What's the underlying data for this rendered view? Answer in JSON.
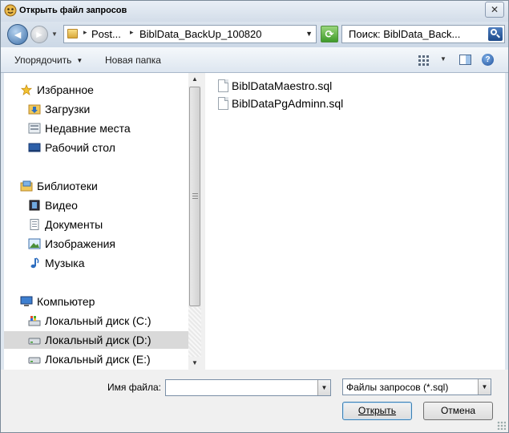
{
  "window": {
    "title": "Открыть файл запросов",
    "close_label": "✕"
  },
  "address": {
    "crumbs": [
      "Post...",
      "BiblData_BackUp_100820"
    ],
    "search_placeholder": "Поиск: BiblData_Back..."
  },
  "toolbar": {
    "organize_label": "Упорядочить",
    "new_folder_label": "Новая папка",
    "help_label": "?"
  },
  "nav": {
    "favorites": {
      "label": "Избранное",
      "icon": "star-icon"
    },
    "favorite_items": [
      {
        "label": "Загрузки",
        "icon": "downloads-folder-icon"
      },
      {
        "label": "Недавние места",
        "icon": "recent-places-icon"
      },
      {
        "label": "Рабочий стол",
        "icon": "desktop-icon"
      }
    ],
    "libraries": {
      "label": "Библиотеки",
      "icon": "libraries-icon"
    },
    "library_items": [
      {
        "label": "Видео",
        "icon": "video-icon"
      },
      {
        "label": "Документы",
        "icon": "documents-icon"
      },
      {
        "label": "Изображения",
        "icon": "pictures-icon"
      },
      {
        "label": "Музыка",
        "icon": "music-icon"
      }
    ],
    "computer": {
      "label": "Компьютер",
      "icon": "computer-icon"
    },
    "drives": [
      {
        "label": "Локальный диск (C:)",
        "icon": "system-drive-icon",
        "selected": false
      },
      {
        "label": "Локальный диск (D:)",
        "icon": "drive-icon",
        "selected": true
      },
      {
        "label": "Локальный диск (E:)",
        "icon": "drive-icon",
        "selected": false
      }
    ]
  },
  "files": [
    {
      "name": "BiblDataMaestro.sql",
      "icon": "sql-file-icon"
    },
    {
      "name": "BiblDataPgAdminn.sql",
      "icon": "sql-file-icon"
    }
  ],
  "bottom": {
    "filename_label": "Имя файла:",
    "filename_value": "",
    "filetype_value": "Файлы запросов (*.sql)",
    "open_label": "Открыть",
    "cancel_label": "Отмена"
  }
}
